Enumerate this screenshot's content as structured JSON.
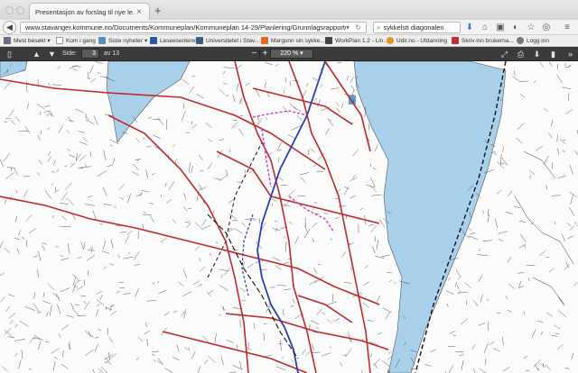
{
  "tab": {
    "title": "Presentasjon av forslag til nye le...",
    "close": "×"
  },
  "new_tab": "+",
  "address": {
    "url": "www.stavanger.kommune.no/Documents/Kommuneplan/Kommuneplan 14-29/Planlering/Grunnlagsrapporter/Presentasjon av for",
    "search_query": "sykkelsti diagonalen"
  },
  "bookmarks": [
    {
      "label": "Mest besøkt",
      "color": "#6a6a8a"
    },
    {
      "label": "Kom i gang",
      "color": "#ffffff"
    },
    {
      "label": "Siste nyheter",
      "color": "#5a8cc8"
    },
    {
      "label": "Leseesenteret",
      "color": "#2a5aa0"
    },
    {
      "label": "Universitetet i Stav...",
      "color": "#3a5a8a"
    },
    {
      "label": "Margunn sin sykke...",
      "color": "#e86820"
    },
    {
      "label": "WorkPlan 1.2 - Lin...",
      "color": "#444444"
    },
    {
      "label": "Udir.no - Utdanning",
      "color": "#e89020"
    },
    {
      "label": "Skriv inn brukerna...",
      "color": "#c03030"
    },
    {
      "label": "Logg inn",
      "color": "#777777"
    }
  ],
  "pdf_toolbar": {
    "page_label": "Side:",
    "page_value": "3",
    "page_total": "av 13",
    "zoom_value": "220 %",
    "zoom_out": "−",
    "zoom_in": "+"
  },
  "colors": {
    "water": "#a8d0ea",
    "road_main": "#c0282a",
    "bike_route": "#2a3fb4",
    "proposed_route": "#c840c8"
  }
}
